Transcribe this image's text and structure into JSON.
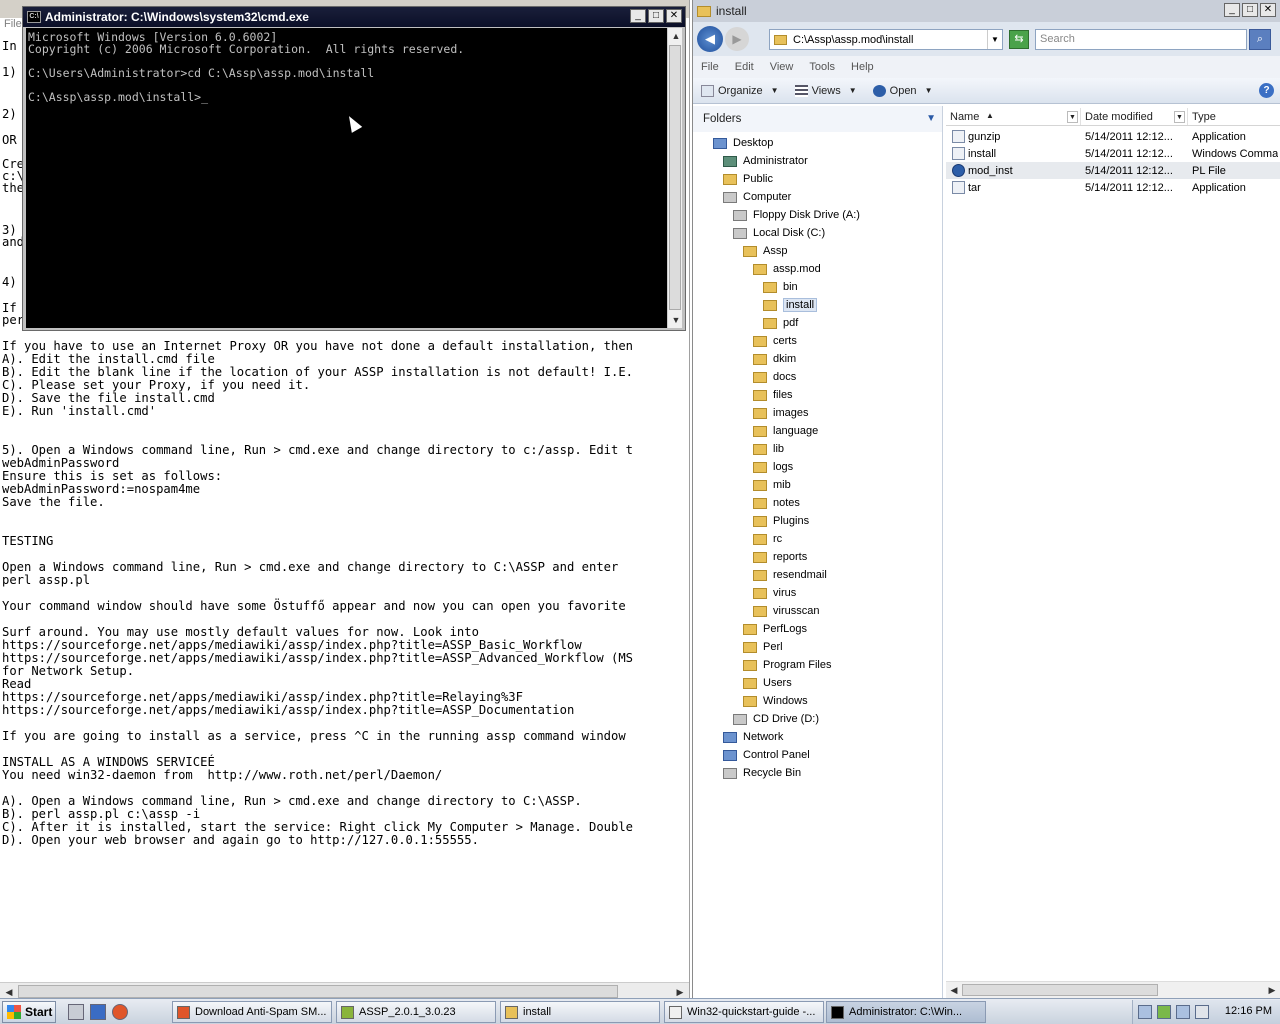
{
  "notepad": {
    "menu": [
      "File"
    ],
    "left_fragments": [
      "In",
      "1)",
      "2)",
      "OR",
      "Cre",
      "c:\\",
      "the",
      "3)",
      "and",
      "4)",
      "If",
      "per"
    ],
    "lines": [
      "If you have to use an Internet Proxy OR you have not done a default installation, then",
      "A). Edit the install.cmd file",
      "B). Edit the blank line if the location of your ASSP installation is not default! I.E.",
      "C). Please set your Proxy, if you need it.",
      "D). Save the file install.cmd",
      "E). Run 'install.cmd'",
      "",
      "",
      "5). Open a Windows command line, Run > cmd.exe and change directory to c:/assp. Edit t",
      "webAdminPassword",
      "Ensure this is set as follows:",
      "webAdminPassword:=nospam4me",
      "Save the file.",
      "",
      "",
      "TESTING",
      "",
      "Open a Windows command line, Run > cmd.exe and change directory to C:\\ASSP and enter",
      "perl assp.pl",
      "",
      "Your command window should have some Östuffő appear and now you can open you favorite",
      "",
      "Surf around. You may use mostly default values for now. Look into",
      "https://sourceforge.net/apps/mediawiki/assp/index.php?title=ASSP_Basic_Workflow",
      "https://sourceforge.net/apps/mediawiki/assp/index.php?title=ASSP_Advanced_Workflow (MS",
      "for Network Setup.",
      "Read",
      "https://sourceforge.net/apps/mediawiki/assp/index.php?title=Relaying%3F",
      "https://sourceforge.net/apps/mediawiki/assp/index.php?title=ASSP_Documentation",
      "",
      "If you are going to install as a service, press ^C in the running assp command window",
      "",
      "INSTALL AS A WINDOWS SERVICEÉ",
      "You need win32-daemon from  http://www.roth.net/perl/Daemon/",
      "",
      "A). Open a Windows command line, Run > cmd.exe and change directory to C:\\ASSP.",
      "B). perl assp.pl c:\\assp -i",
      "C). After it is installed, start the service: Right click My Computer > Manage. Double",
      "D). Open your web browser and again go to http://127.0.0.1:55555."
    ]
  },
  "cmd": {
    "title": "Administrator: C:\\Windows\\system32\\cmd.exe",
    "lines": [
      "Microsoft Windows [Version 6.0.6002]",
      "Copyright (c) 2006 Microsoft Corporation.  All rights reserved.",
      "",
      "C:\\Users\\Administrator>cd C:\\Assp\\assp.mod\\install",
      "",
      "C:\\Assp\\assp.mod\\install>_"
    ],
    "text_color": "#c0c0c0",
    "bg_color": "#000000"
  },
  "explorer": {
    "title": "install",
    "address": "C:\\Assp\\assp.mod\\install",
    "search_placeholder": "Search",
    "menu": [
      "File",
      "Edit",
      "View",
      "Tools",
      "Help"
    ],
    "toolbar": {
      "organize": "Organize",
      "views": "Views",
      "open": "Open"
    },
    "folders_header": "Folders",
    "tree": [
      {
        "label": "Desktop",
        "depth": 0,
        "icon": "blue"
      },
      {
        "label": "Administrator",
        "depth": 1,
        "icon": "user"
      },
      {
        "label": "Public",
        "depth": 1,
        "icon": "folder"
      },
      {
        "label": "Computer",
        "depth": 1,
        "icon": "gray"
      },
      {
        "label": "Floppy Disk Drive (A:)",
        "depth": 2,
        "icon": "gray"
      },
      {
        "label": "Local Disk (C:)",
        "depth": 2,
        "icon": "gray"
      },
      {
        "label": "Assp",
        "depth": 3,
        "icon": "folder"
      },
      {
        "label": "assp.mod",
        "depth": 4,
        "icon": "folder"
      },
      {
        "label": "bin",
        "depth": 5,
        "icon": "folder"
      },
      {
        "label": "install",
        "depth": 5,
        "icon": "folder",
        "selected": true
      },
      {
        "label": "pdf",
        "depth": 5,
        "icon": "folder"
      },
      {
        "label": "certs",
        "depth": 4,
        "icon": "folder"
      },
      {
        "label": "dkim",
        "depth": 4,
        "icon": "folder"
      },
      {
        "label": "docs",
        "depth": 4,
        "icon": "folder"
      },
      {
        "label": "files",
        "depth": 4,
        "icon": "folder"
      },
      {
        "label": "images",
        "depth": 4,
        "icon": "folder"
      },
      {
        "label": "language",
        "depth": 4,
        "icon": "folder"
      },
      {
        "label": "lib",
        "depth": 4,
        "icon": "folder"
      },
      {
        "label": "logs",
        "depth": 4,
        "icon": "folder"
      },
      {
        "label": "mib",
        "depth": 4,
        "icon": "folder"
      },
      {
        "label": "notes",
        "depth": 4,
        "icon": "folder"
      },
      {
        "label": "Plugins",
        "depth": 4,
        "icon": "folder"
      },
      {
        "label": "rc",
        "depth": 4,
        "icon": "folder"
      },
      {
        "label": "reports",
        "depth": 4,
        "icon": "folder"
      },
      {
        "label": "resendmail",
        "depth": 4,
        "icon": "folder"
      },
      {
        "label": "virus",
        "depth": 4,
        "icon": "folder"
      },
      {
        "label": "virusscan",
        "depth": 4,
        "icon": "folder"
      },
      {
        "label": "PerfLogs",
        "depth": 3,
        "icon": "folder"
      },
      {
        "label": "Perl",
        "depth": 3,
        "icon": "folder"
      },
      {
        "label": "Program Files",
        "depth": 3,
        "icon": "folder"
      },
      {
        "label": "Users",
        "depth": 3,
        "icon": "folder"
      },
      {
        "label": "Windows",
        "depth": 3,
        "icon": "folder"
      },
      {
        "label": "CD Drive (D:)",
        "depth": 2,
        "icon": "gray"
      },
      {
        "label": "Network",
        "depth": 1,
        "icon": "blue"
      },
      {
        "label": "Control Panel",
        "depth": 1,
        "icon": "blue"
      },
      {
        "label": "Recycle Bin",
        "depth": 1,
        "icon": "gray"
      }
    ],
    "columns": [
      "Name",
      "Date modified",
      "Type"
    ],
    "files": [
      {
        "name": "gunzip",
        "date": "5/14/2011 12:12...",
        "type": "Application",
        "icon": "app"
      },
      {
        "name": "install",
        "date": "5/14/2011 12:12...",
        "type": "Windows Comma",
        "icon": "app"
      },
      {
        "name": "mod_inst",
        "date": "5/14/2011 12:12...",
        "type": "PL File",
        "icon": "pl",
        "highlight": true
      },
      {
        "name": "tar",
        "date": "5/14/2011 12:12...",
        "type": "Application",
        "icon": "app"
      }
    ]
  },
  "taskbar": {
    "start": "Start",
    "tasks": [
      {
        "label": "Download Anti-Spam SM...",
        "icon_color": "#e0562a"
      },
      {
        "label": "ASSP_2.0.1_3.0.23",
        "icon_color": "#8ab43c"
      },
      {
        "label": "install",
        "icon_color": "#e8c15a"
      },
      {
        "label": "Win32-quickstart-guide -...",
        "icon_color": "#f0f0f0"
      },
      {
        "label": "Administrator: C:\\Win...",
        "icon_color": "#000000",
        "active": true
      }
    ],
    "clock": "12:16 PM"
  }
}
